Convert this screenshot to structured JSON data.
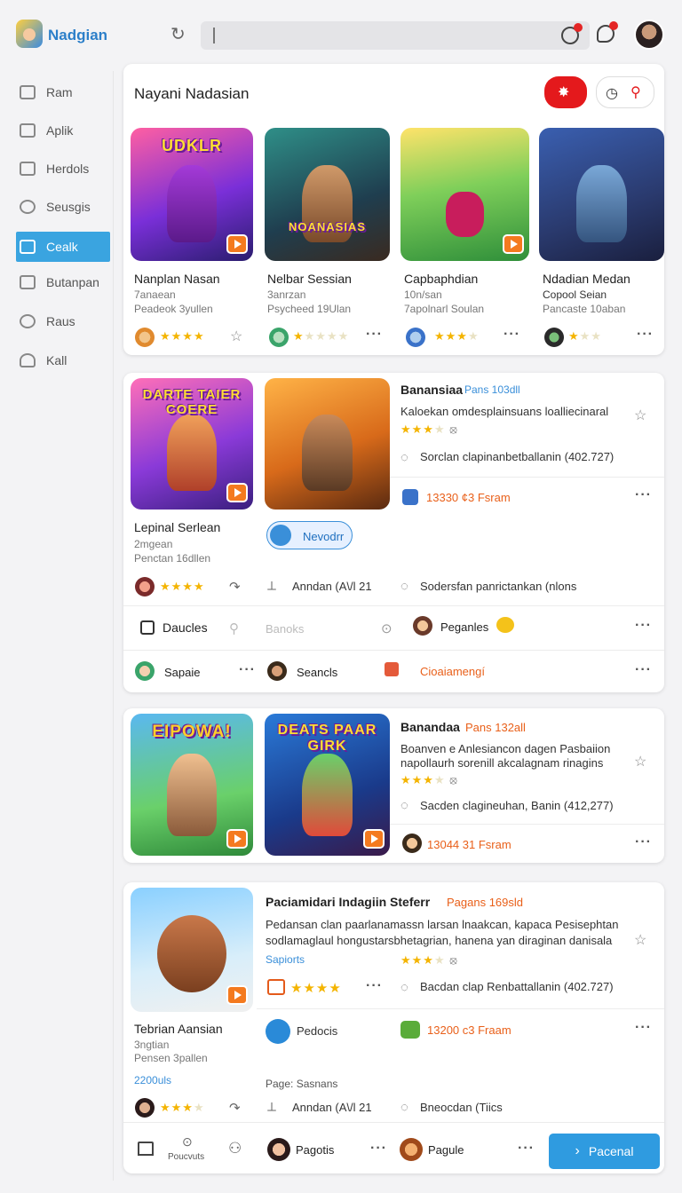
{
  "app": {
    "name": "Nadgian"
  },
  "sidebar": {
    "items": [
      {
        "label": "Ram"
      },
      {
        "label": "Aplik"
      },
      {
        "label": "Herdols"
      },
      {
        "label": "Seusgis"
      },
      {
        "label": "Cealk",
        "active": true
      },
      {
        "label": "Butanpan"
      },
      {
        "label": "Raus"
      },
      {
        "label": "Kall"
      }
    ]
  },
  "section": {
    "title": "Nayani Nadasian"
  },
  "games": [
    {
      "title": "Nanplan Nasan",
      "line1": "7anaean",
      "line2": "Peadeok 3yullen",
      "art_title": "UDKLR",
      "rating": 4
    },
    {
      "title": "Nelbar Sessian",
      "line1": "3anrzan",
      "line2": "Psycheed 19Ulan",
      "art_title": "NOANASIAS",
      "rating": 1
    },
    {
      "title": "Capbaphdian",
      "line1": "10n/san",
      "line2": "7apolnarl Soulan",
      "rating": 3
    },
    {
      "title": "Ndadian Medan",
      "line1": "Copool Seian",
      "line2": "Pancaste 10aban",
      "rating": 1
    }
  ],
  "feature1": {
    "art_title": "DARTE TAIER COERE",
    "name": "Lepinal Serlean",
    "line1": "2mgean",
    "line2": "Penctan 16dllen",
    "button": "Nevodrr",
    "head": "Banansiaa",
    "head_tag": "Pans 103dll",
    "desc": "Kaloekan omdesplainsuans loalliecinaral",
    "stat": "Sorclan clapinanbetballanin (402.727)",
    "price": "13330 ¢3 Fsram",
    "share": "Anndan (A\\/l 21",
    "comment": "Sodersfan panrictankan (nlons"
  },
  "rows": {
    "row1": [
      {
        "label": "Daucles"
      },
      {
        "label": "Banoks"
      },
      {
        "label": "Peganles"
      }
    ],
    "row2": [
      {
        "label": "Sapaie"
      },
      {
        "label": "Seancls"
      },
      {
        "label": "Cioaiamengí"
      }
    ]
  },
  "feature2": {
    "art1": "EIPOWA!",
    "art2": "DEATS PAAR GIRK",
    "head": "Banandaa",
    "head_tag": "Pans 132all",
    "desc1": "Boanven e Anlesiancon dagen Pasbaiion",
    "desc2": "napollaurh sorenill akcalagnam rinagins",
    "stat": "Sacden clagineuhan, Banin (412,277)",
    "price": "13044 31 Fsram"
  },
  "feature3": {
    "head": "Paciamidari Indagiin Steferr",
    "head_tag": "Pagans 169sld",
    "desc1": "Pedansan clan paarlanamassn larsan lnaakcan, kapaca Pesisephtan",
    "desc2": "sodlamaglaul hongustarsbhetagrian, hanena yan diraginan danisala",
    "tag": "Sapiorts",
    "stat": "Bacdan clap Renbattallanin (402.727)",
    "name": "Tebrian Aansian",
    "line1": "3ngtian",
    "line2": "Pensen 3pallen",
    "link": "2200uls",
    "btn": "Pedocis",
    "price": "13200 c3 Fraam",
    "page_label": "Page: Sasnans",
    "share": "Anndan (A\\/l 21",
    "comment": "Bneocdan (Tiics"
  },
  "bottombar": {
    "home": "",
    "tab2": "Poucvuts",
    "user1": "Pagotis",
    "user2": "Pagule",
    "primary": "Pacenal"
  }
}
